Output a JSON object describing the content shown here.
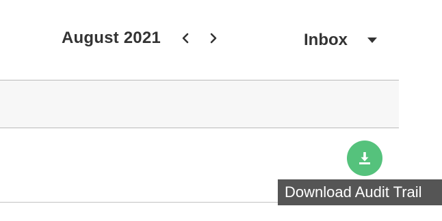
{
  "calendar": {
    "month_label": "August 2021",
    "prev_icon": "chevron-left-icon",
    "next_icon": "chevron-right-icon"
  },
  "inbox_select": {
    "label": "Inbox",
    "icon": "caret-down-icon"
  },
  "download": {
    "icon": "download-icon",
    "tooltip": "Download Audit Trail",
    "color": "#55c27c"
  }
}
